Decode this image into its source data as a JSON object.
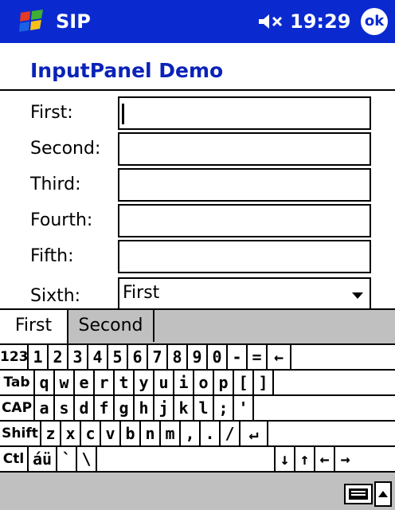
{
  "titlebar": {
    "title": "SIP",
    "time": "19:29",
    "ok_label": "ok",
    "start_icon": "windows-flag-icon",
    "volume_icon": "volume-muted-icon"
  },
  "app": {
    "header": "InputPanel Demo"
  },
  "form": {
    "fields": [
      {
        "label": "First:",
        "value": ""
      },
      {
        "label": "Second:",
        "value": ""
      },
      {
        "label": "Third:",
        "value": ""
      },
      {
        "label": "Fourth:",
        "value": ""
      },
      {
        "label": "Fifth:",
        "value": ""
      }
    ],
    "select": {
      "label": "Sixth:",
      "value": "First"
    }
  },
  "tabs": [
    {
      "label": "First",
      "active": true
    },
    {
      "label": "Second",
      "active": false
    }
  ],
  "keyboard": {
    "rows": [
      [
        "123",
        "1",
        "2",
        "3",
        "4",
        "5",
        "6",
        "7",
        "8",
        "9",
        "0",
        "-",
        "=",
        "←"
      ],
      [
        "Tab",
        "q",
        "w",
        "e",
        "r",
        "t",
        "y",
        "u",
        "i",
        "o",
        "p",
        "[",
        "]"
      ],
      [
        "CAP",
        "a",
        "s",
        "d",
        "f",
        "g",
        "h",
        "j",
        "k",
        "l",
        ";",
        "'"
      ],
      [
        "Shift",
        "z",
        "x",
        "c",
        "v",
        "b",
        "n",
        "m",
        ",",
        ".",
        "/",
        "↵"
      ],
      [
        "Ctl",
        "áü",
        "`",
        "\\",
        " ",
        "↓",
        "↑",
        "←",
        "→"
      ]
    ]
  },
  "bottombar": {
    "keyboard_icon": "keyboard-icon",
    "sip_arrow": "up-arrow-icon"
  },
  "colors": {
    "titlebar": "#0a2ad0",
    "header_text": "#0a22b8",
    "panel_gray": "#c0c0c0"
  }
}
